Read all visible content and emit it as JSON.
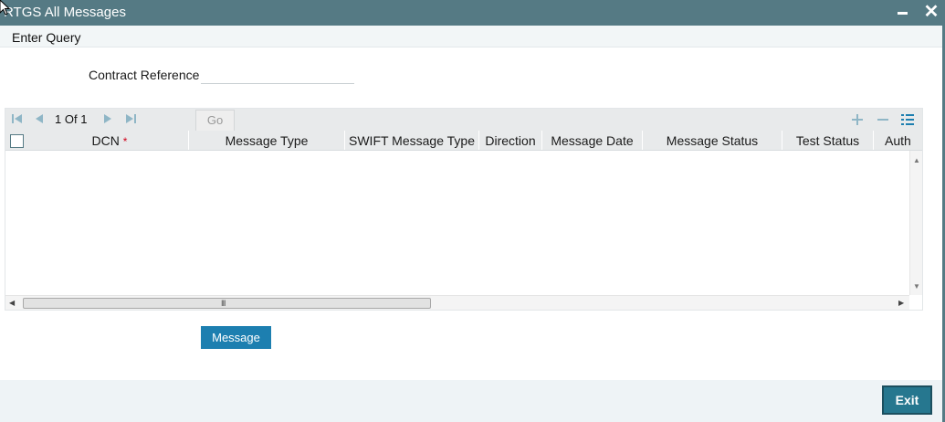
{
  "window": {
    "title": "RTGS All Messages",
    "minimize_icon": "minimize-icon",
    "close_icon": "close-icon",
    "titlebar_color": "#557a84"
  },
  "menubar": {
    "enter_query": "Enter Query"
  },
  "query": {
    "contract_reference_label": "Contract Reference",
    "contract_reference_value": ""
  },
  "grid": {
    "pager": {
      "current": "1",
      "of_label": "Of",
      "total": "1",
      "go_label": "Go"
    },
    "toolbar_icons": [
      "first-page-icon",
      "previous-page-icon",
      "next-page-icon",
      "last-page-icon",
      "add-row-icon",
      "delete-row-icon",
      "single-view-icon"
    ],
    "columns": [
      {
        "label": "DCN",
        "required": "*"
      },
      {
        "label": "Message Type"
      },
      {
        "label": "SWIFT Message Type"
      },
      {
        "label": "Direction"
      },
      {
        "label": "Message Date"
      },
      {
        "label": "Message Status"
      },
      {
        "label": "Test Status"
      },
      {
        "label": "Auth"
      }
    ],
    "rows": []
  },
  "actions": {
    "message_label": "Message",
    "exit_label": "Exit"
  },
  "colors": {
    "accent": "#1d7fb0",
    "exit_button": "#26778f",
    "footer_bg": "#eef3f6"
  }
}
